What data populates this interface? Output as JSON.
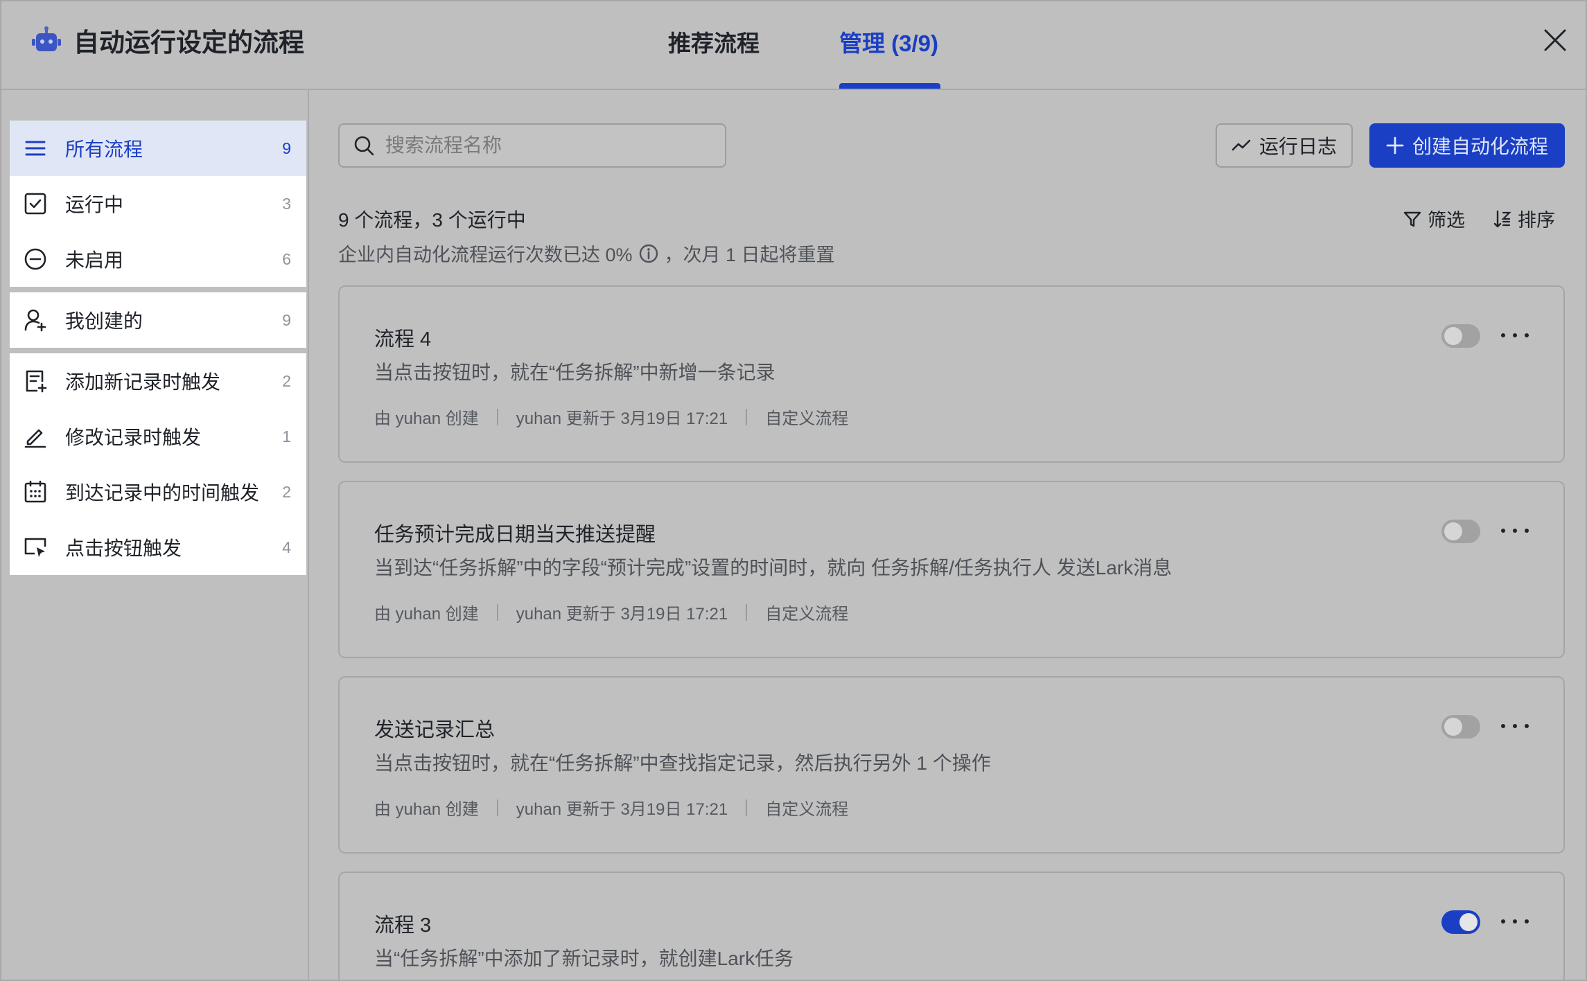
{
  "header": {
    "app_title": "自动运行设定的流程",
    "tabs": [
      {
        "label": "推荐流程",
        "active": false
      },
      {
        "label": "管理 (3/9)",
        "active": true
      }
    ]
  },
  "sidebar": {
    "groups": [
      [
        {
          "label": "所有流程",
          "count": "9",
          "icon": "list-icon",
          "active": true
        },
        {
          "label": "运行中",
          "count": "3",
          "icon": "check-square-icon"
        },
        {
          "label": "未启用",
          "count": "6",
          "icon": "minus-circle-icon"
        }
      ],
      [
        {
          "label": "我创建的",
          "count": "9",
          "icon": "user-add-icon"
        }
      ],
      [
        {
          "label": "添加新记录时触发",
          "count": "2",
          "icon": "add-record-icon"
        },
        {
          "label": "修改记录时触发",
          "count": "1",
          "icon": "edit-icon"
        },
        {
          "label": "到达记录中的时间触发",
          "count": "2",
          "icon": "calendar-icon"
        },
        {
          "label": "点击按钮触发",
          "count": "4",
          "icon": "click-button-icon"
        }
      ]
    ]
  },
  "toolbar": {
    "search_placeholder": "搜索流程名称",
    "log_label": "运行日志",
    "create_label": "创建自动化流程",
    "filter_label": "筛选",
    "sort_label": "排序"
  },
  "summary": {
    "count_text": "9 个流程，3 个运行中",
    "usage_before": "企业内自动化流程运行次数已达 0%",
    "usage_after": "，次月 1 日起将重置"
  },
  "flows": [
    {
      "title": "流程 4",
      "desc": "当点击按钮时，就在“任务拆解”中新增一条记录",
      "creator": "由 yuhan 创建",
      "updated": "yuhan 更新于 3月19日 17:21",
      "kind": "自定义流程",
      "enabled": false
    },
    {
      "title": "任务预计完成日期当天推送提醒",
      "desc": "当到达“任务拆解”中的字段“预计完成”设置的时间时，就向 任务拆解/任务执行人 发送Lark消息",
      "creator": "由 yuhan 创建",
      "updated": "yuhan 更新于 3月19日 17:21",
      "kind": "自定义流程",
      "enabled": false
    },
    {
      "title": "发送记录汇总",
      "desc": "当点击按钮时，就在“任务拆解”中查找指定记录，然后执行另外 1 个操作",
      "creator": "由 yuhan 创建",
      "updated": "yuhan 更新于 3月19日 17:21",
      "kind": "自定义流程",
      "enabled": false
    },
    {
      "title": "流程 3",
      "desc": "当“任务拆解”中添加了新记录时，就创建Lark任务",
      "creator": "",
      "updated": "",
      "kind": "",
      "enabled": true
    }
  ],
  "colors": {
    "accent": "#1a3fc4",
    "overlay": "#bfbfbf"
  }
}
